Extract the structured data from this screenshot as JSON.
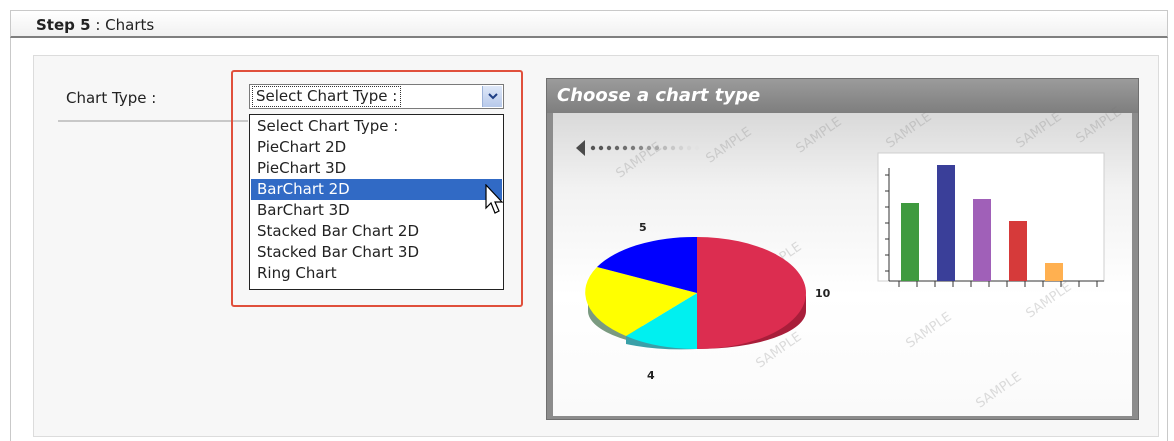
{
  "header": {
    "step_label": "Step 5",
    "separator": " : ",
    "section": "Charts"
  },
  "form": {
    "chart_type_label": "Chart Type :",
    "select_value": "Select Chart Type :"
  },
  "dropdown": {
    "options": [
      "Select Chart Type :",
      "PieChart 2D",
      "PieChart 3D",
      "BarChart 2D",
      "BarChart 3D",
      "Stacked Bar Chart 2D",
      "Stacked Bar Chart 3D",
      "Ring Chart"
    ],
    "highlighted_index": 3
  },
  "preview": {
    "title": "Choose a chart type",
    "watermark": "SAMPLE",
    "pie": {
      "labels": [
        "5",
        "10",
        "4"
      ],
      "colors": {
        "crimson": "#dc2d50",
        "cyan": "#00f0f0",
        "yellow": "#ffff00",
        "blue": "#0000ff"
      }
    },
    "bars": {
      "values": [
        4,
        6,
        4.2,
        2.8,
        0.8
      ],
      "colors": [
        "#3f9a3f",
        "#3a3f99",
        "#a060b8",
        "#d63a3a",
        "#ffb050"
      ]
    }
  },
  "colors": {
    "highlight_border": "#e0503c",
    "selection": "#316ac5"
  }
}
